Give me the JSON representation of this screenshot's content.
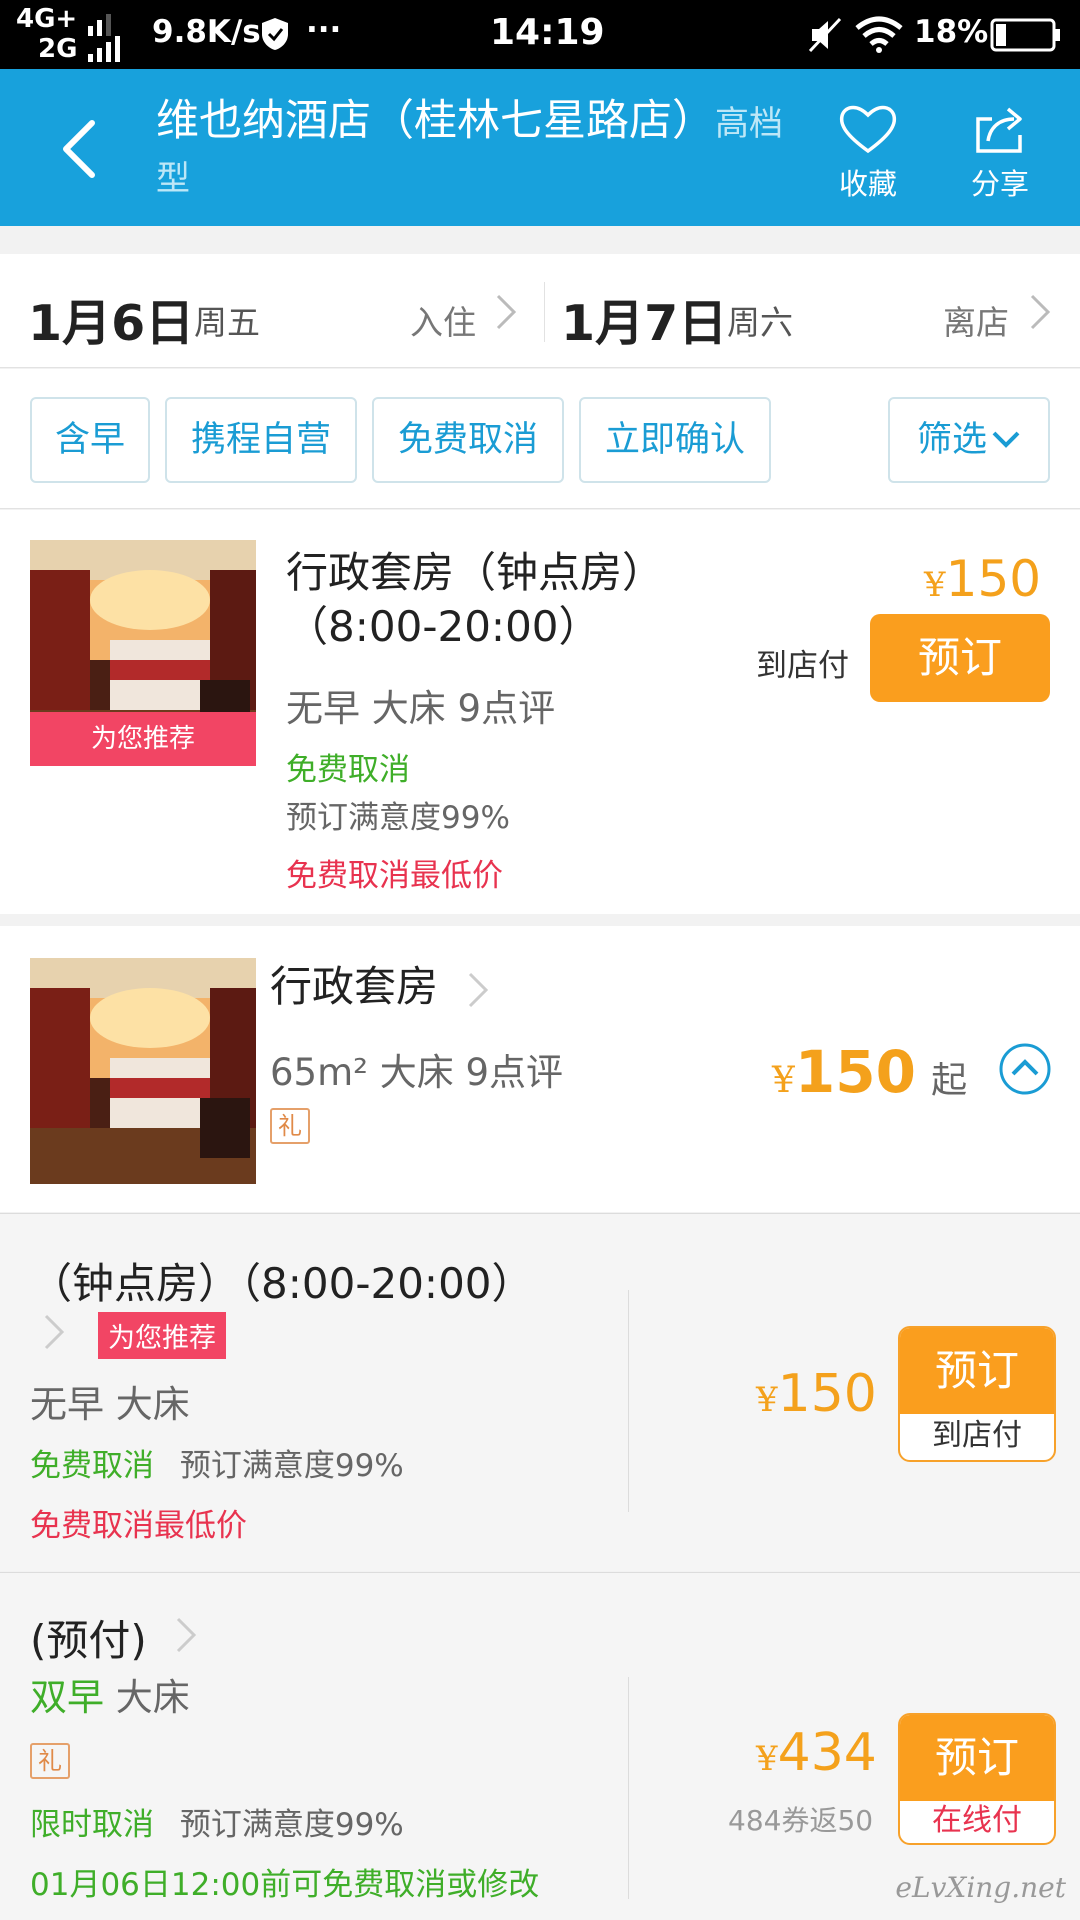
{
  "status_bar": {
    "network_top": "4G+",
    "network_bottom": "2G",
    "speed": "9.8K/s",
    "more": "···",
    "time": "14:19",
    "battery": "18%"
  },
  "header": {
    "hotel_name": "维也纳酒店（桂林七星路店）",
    "grade": "高档型",
    "favorite_label": "收藏",
    "share_label": "分享"
  },
  "dates": {
    "checkin_date": "1月6日",
    "checkin_weekday": "周五",
    "checkin_action": "入住",
    "checkout_date": "1月7日",
    "checkout_weekday": "周六",
    "checkout_action": "离店"
  },
  "filters": {
    "chips": [
      "含早",
      "携程自营",
      "免费取消",
      "立即确认"
    ],
    "filter_label": "筛选"
  },
  "featured_room": {
    "ribbon": "为您推荐",
    "name_line1": "行政套房（钟点房）",
    "name_line2": "（8:00-20:00）",
    "meta": "无早 大床 9点评",
    "cancel": "免费取消",
    "satisfaction": "预订满意度99%",
    "promo": "免费取消最低价",
    "currency": "¥",
    "price": "150",
    "pay_type": "到店付",
    "book_label": "预订"
  },
  "room_type": {
    "name": "行政套房",
    "area": "65m²",
    "meta": "大床 9点评",
    "gift": "礼",
    "currency": "¥",
    "price": "150",
    "price_suffix": "起"
  },
  "rates": [
    {
      "name": "（钟点房）（8:00-20:00）",
      "tag": "为您推荐",
      "meta": "无早 大床",
      "cancel": "免费取消",
      "satisfaction": "预订满意度99%",
      "promo": "免费取消最低价",
      "currency": "¥",
      "price": "150",
      "book_label": "预订",
      "pay_type": "到店付"
    },
    {
      "name": "(预付)",
      "breakfast": "双早",
      "bed": "大床",
      "gift": "礼",
      "cancel": "限时取消",
      "satisfaction": "预订满意度99%",
      "deadline": "01月06日12:00前可免费取消或修改",
      "currency": "¥",
      "price": "434",
      "coupon": "484券返50",
      "book_label": "预订",
      "pay_type": "在线付"
    }
  ],
  "watermark": "eLvXing.net",
  "colors": {
    "header_bg": "#18a1dc",
    "accent_orange": "#fa9e1e",
    "price_orange": "#f4a11c",
    "green": "#3fae29",
    "red": "#e8334f",
    "chip_blue": "#1a9cd4"
  }
}
